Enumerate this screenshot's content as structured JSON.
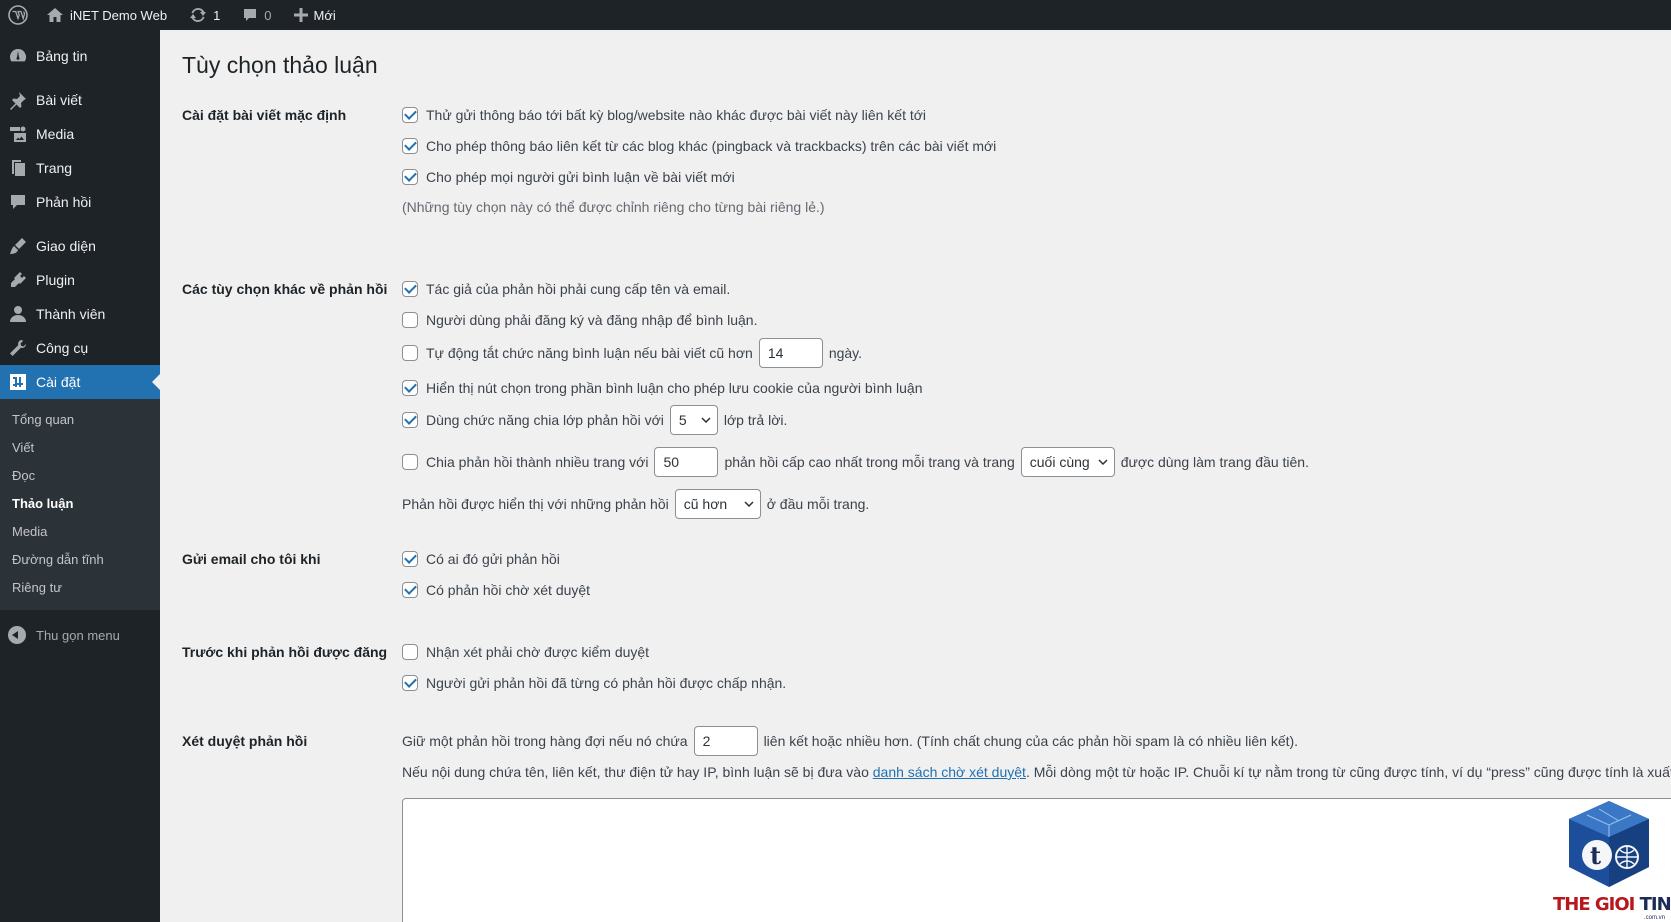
{
  "adminbar": {
    "site_name": "iNET Demo Web",
    "updates_count": "1",
    "comments_count": "0",
    "new_label": "Mới"
  },
  "sidebar": {
    "items": [
      {
        "label": "Bảng tin",
        "icon": "dashboard-icon"
      },
      {
        "label": "Bài viết",
        "icon": "pin-icon"
      },
      {
        "label": "Media",
        "icon": "media-icon"
      },
      {
        "label": "Trang",
        "icon": "page-icon"
      },
      {
        "label": "Phản hồi",
        "icon": "comment-icon"
      },
      {
        "label": "Giao diện",
        "icon": "brush-icon"
      },
      {
        "label": "Plugin",
        "icon": "plugin-icon"
      },
      {
        "label": "Thành viên",
        "icon": "user-icon"
      },
      {
        "label": "Công cụ",
        "icon": "wrench-icon"
      },
      {
        "label": "Cài đặt",
        "icon": "settings-icon"
      }
    ],
    "submenu": [
      "Tổng quan",
      "Viết",
      "Đọc",
      "Thảo luận",
      "Media",
      "Đường dẫn tĩnh",
      "Riêng tư"
    ],
    "collapse_label": "Thu gọn menu"
  },
  "page": {
    "title": "Tùy chọn thảo luận",
    "sections": {
      "default_post": {
        "label": "Cài đặt bài viết mặc định",
        "opt1": "Thử gửi thông báo tới bất kỳ blog/website nào khác được bài viết này liên kết tới",
        "opt2": "Cho phép thông báo liên kết từ các blog khác (pingback và trackbacks) trên các bài viết mới",
        "opt3": "Cho phép mọi người gửi bình luận về bài viết mới",
        "note": "(Những tùy chọn này có thể được chỉnh riêng cho từng bài riêng lẻ.)"
      },
      "other": {
        "label": "Các tùy chọn khác về phản hồi",
        "opt1": "Tác giả của phản hồi phải cung cấp tên và email.",
        "opt2": "Người dùng phải đăng ký và đăng nhập để bình luận.",
        "opt3_pre": "Tự động tắt chức năng bình luận nếu bài viết cũ hơn",
        "opt3_value": "14",
        "opt3_post": "ngày.",
        "opt4": "Hiển thị nút chọn trong phần bình luận cho phép lưu cookie của người bình luận",
        "opt5_pre": "Dùng chức năng chia lớp phản hồi với",
        "opt5_value": "5",
        "opt5_post": "lớp trả lời.",
        "opt6_pre": "Chia phản hồi thành nhiều trang với",
        "opt6_value": "50",
        "opt6_mid": "phản hồi cấp cao nhất trong mỗi trang và trang",
        "opt6_select": "cuối cùng",
        "opt6_post": "được dùng làm trang đầu tiên.",
        "order_pre": "Phản hồi được hiển thị với những phản hồi",
        "order_select": "cũ hơn",
        "order_post": "ở đầu mỗi trang."
      },
      "email": {
        "label": "Gửi email cho tôi khi",
        "opt1": "Có ai đó gửi phản hồi",
        "opt2": "Có phản hồi chờ xét duyệt"
      },
      "before": {
        "label": "Trước khi phản hồi được đăng",
        "opt1": "Nhận xét phải chờ được kiểm duyệt",
        "opt2": "Người gửi phản hồi đã từng có phản hồi được chấp nhận."
      },
      "moderation": {
        "label": "Xét duyệt phản hồi",
        "line1_pre": "Giữ một phản hồi trong hàng đợi nếu nó chứa",
        "line1_value": "2",
        "line1_post": "liên kết hoặc nhiều hơn. (Tính chất chung của các phản hồi spam là có nhiều liên kết).",
        "line2_pre": "Nếu nội dung chứa tên, liên kết, thư điện tử hay IP, bình luận sẽ bị đưa vào",
        "line2_link": "danh sách chờ xét duyệt",
        "line2_post": ". Mỗi dòng một từ hoặc IP. Chuỗi kí tự nằm trong từ cũng được tính, ví dụ “press” cũng được tính là xuất hiện"
      }
    }
  },
  "watermark": {
    "brand_red": "THE GIOI ",
    "brand_dark": "TINHOC",
    "domain": ".com.vn"
  }
}
